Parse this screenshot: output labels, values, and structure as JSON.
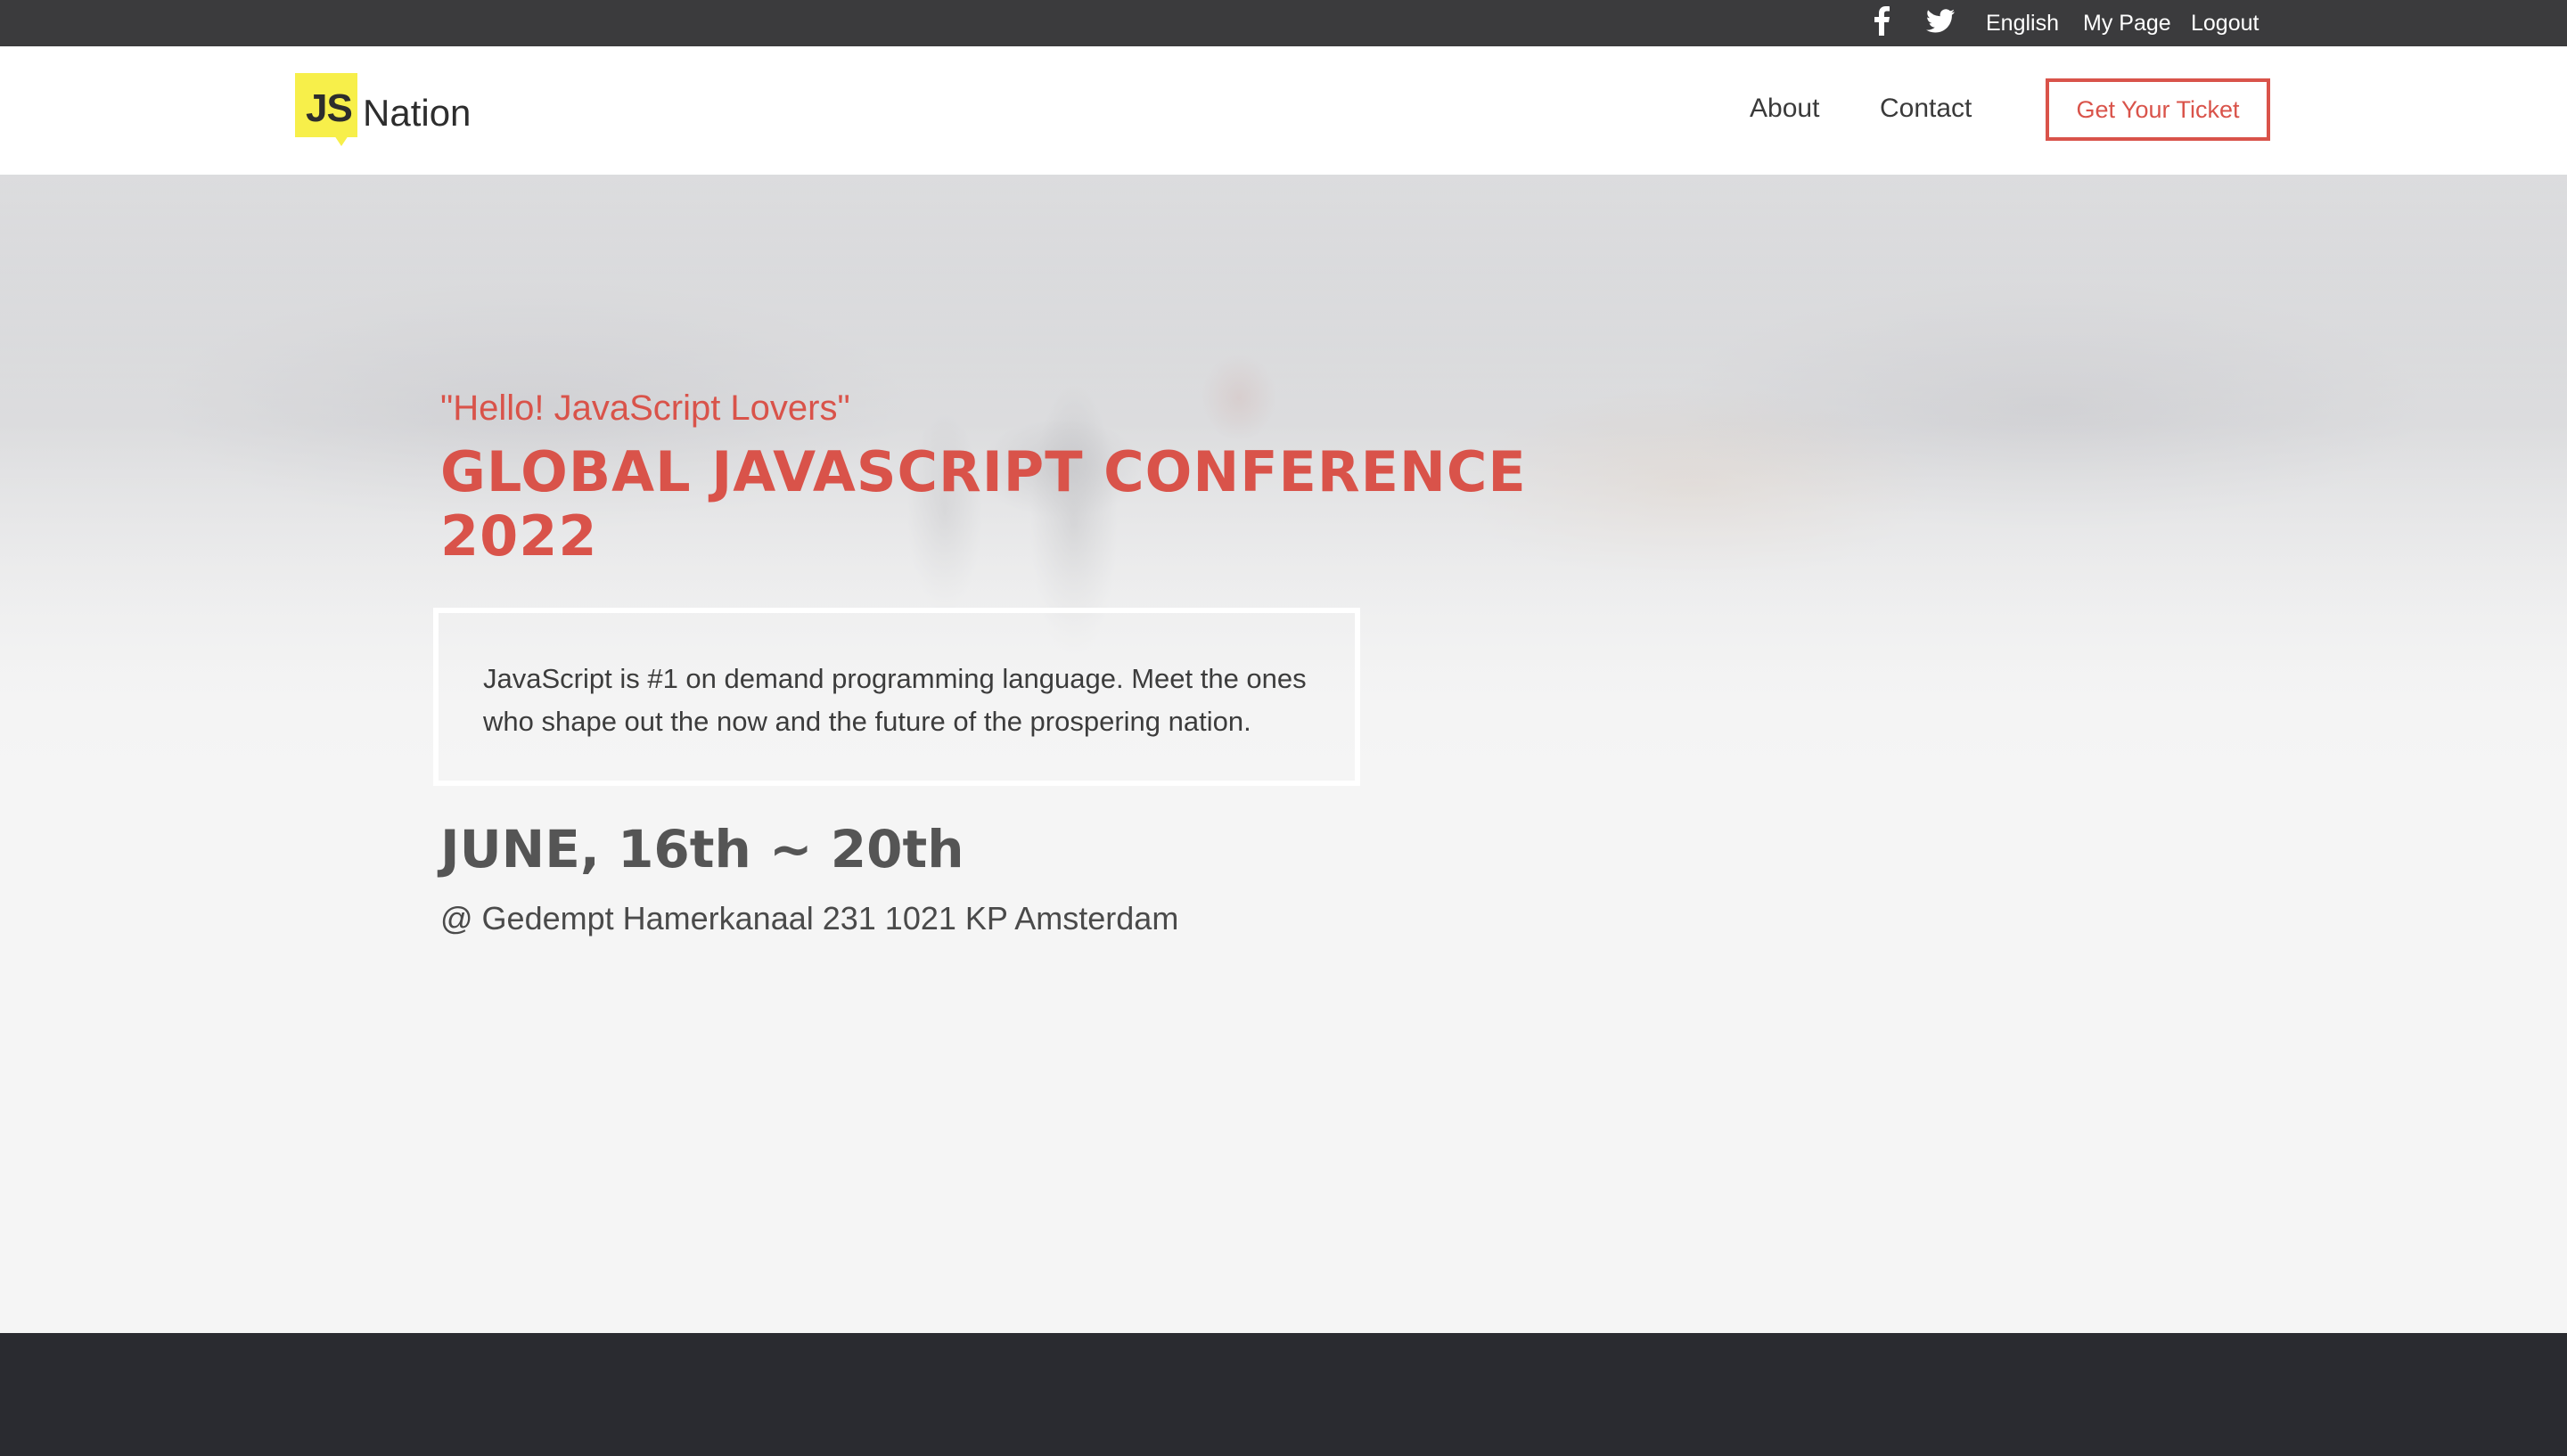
{
  "topbar": {
    "icons": [
      "facebook-icon",
      "twitter-icon"
    ],
    "language": "English",
    "my_page": "My Page",
    "logout": "Logout"
  },
  "header": {
    "logo": {
      "mark": "JS",
      "name": "Nation"
    },
    "nav": {
      "about": "About",
      "contact": "Contact"
    },
    "cta_label": "Get Your Ticket"
  },
  "hero": {
    "greeting": "\"Hello! JavaScript Lovers\"",
    "headline": "GLOBAL JAVASCRIPT CONFERENCE 2022",
    "description": "JavaScript is #1 on demand programming language. Meet the ones who shape out the now and the future of the prospering nation.",
    "dates": "JUNE, 16th ~ 20th",
    "venue": "@ Gedempt Hamerkanaal 231 1021 KP Amsterdam"
  },
  "colors": {
    "accent": "#d9534a",
    "logo_yellow": "#f7ef4a",
    "topbar_bg": "#3b3b3d",
    "footer_bg": "#2a2b30"
  }
}
